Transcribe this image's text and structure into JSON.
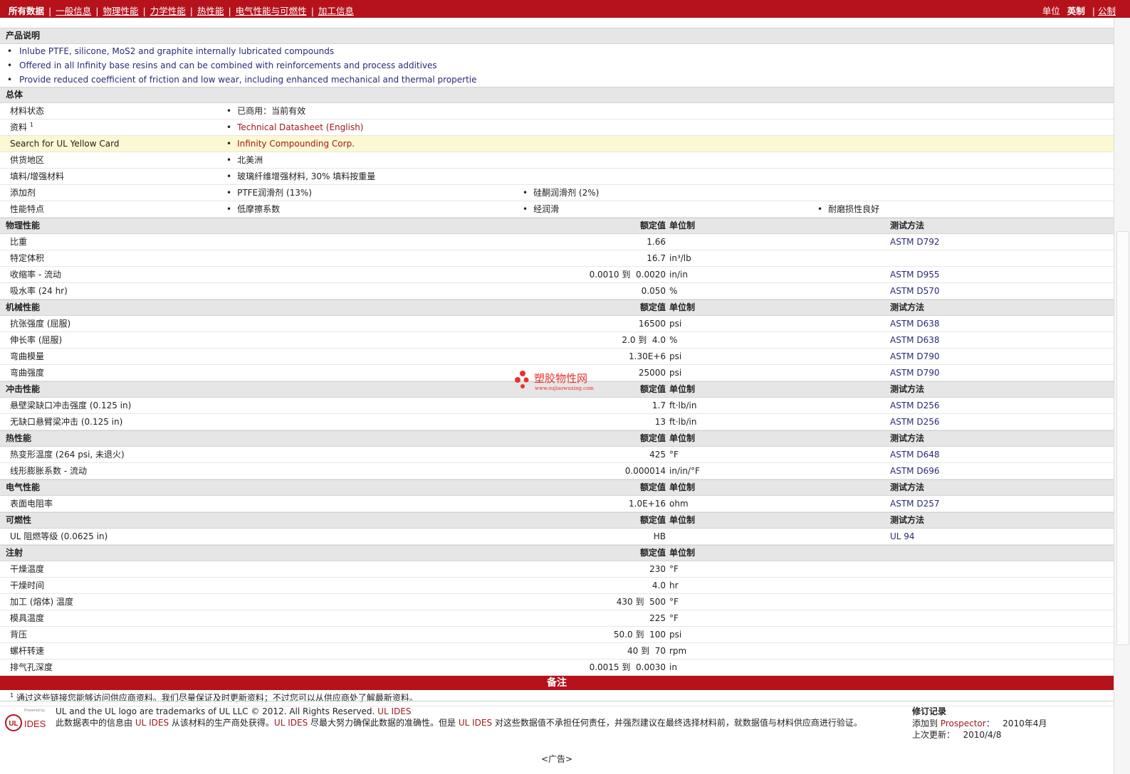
{
  "topbar": {
    "nav": [
      "所有数据",
      "一般信息",
      "物理性能",
      "力学性能",
      "热性能",
      "电气性能与可燃性",
      "加工信息"
    ],
    "units_label": "单位",
    "unit_selected": "英制",
    "unit_other": "公制",
    "bg_color": "#b5121b"
  },
  "product": {
    "heading": "产品说明",
    "bullets": [
      "Inlube PTFE, silicone, MoS2 and graphite internally lubricated compounds",
      "Offered in all Infinity base resins and can be combined with reinforcements and process additives",
      "Provide reduced coefficient of friction and low wear, including enhanced mechanical and thermal propertie"
    ]
  },
  "general": {
    "heading": "总体",
    "rows": [
      {
        "label": "材料状态",
        "sup": "",
        "cols": [
          "已商用：当前有效"
        ],
        "link": false,
        "hl": false
      },
      {
        "label": "资料",
        "sup": "1",
        "cols": [
          "Technical Datasheet (English)"
        ],
        "link": true,
        "hl": false
      },
      {
        "label": "Search for UL Yellow Card",
        "sup": "",
        "cols": [
          "Infinity Compounding Corp."
        ],
        "link": true,
        "hl": true
      },
      {
        "label": "供货地区",
        "sup": "",
        "cols": [
          "北美洲"
        ],
        "link": false,
        "hl": false
      },
      {
        "label": "填料/增强材料",
        "sup": "",
        "cols": [
          "玻璃纤维增强材料, 30% 填料按重量"
        ],
        "link": false,
        "hl": false
      },
      {
        "label": "添加剂",
        "sup": "",
        "cols": [
          "PTFE润滑剂 (13%)",
          "硅酮润滑剂 (2%)"
        ],
        "link": false,
        "hl": false
      },
      {
        "label": "性能特点",
        "sup": "",
        "cols": [
          "低摩擦系数",
          "经润滑",
          "耐磨损性良好"
        ],
        "link": false,
        "hl": false
      }
    ]
  },
  "headers": {
    "nominal": "额定值",
    "unit": "单位制",
    "method": "测试方法"
  },
  "sections": [
    {
      "name": "physical",
      "title": "物理性能",
      "show_method": true,
      "rows": [
        {
          "label": "比重",
          "value": "1.66",
          "unit": "",
          "method": "ASTM D792"
        },
        {
          "label": "特定体积",
          "value": "16.7",
          "unit": "in³/lb",
          "method": ""
        },
        {
          "label": "收缩率 - 流动",
          "value": "0.0010 到  0.0020",
          "unit": "in/in",
          "method": "ASTM D955"
        },
        {
          "label": "吸水率 (24 hr)",
          "value": "0.050",
          "unit": "%",
          "method": "ASTM D570"
        }
      ]
    },
    {
      "name": "mechanical",
      "title": "机械性能",
      "show_method": true,
      "rows": [
        {
          "label": "抗张强度 (屈服)",
          "value": "16500",
          "unit": "psi",
          "method": "ASTM D638"
        },
        {
          "label": "伸长率 (屈服)",
          "value": "2.0 到  4.0",
          "unit": "%",
          "method": "ASTM D638"
        },
        {
          "label": "弯曲模量",
          "value": "1.30E+6",
          "unit": "psi",
          "method": "ASTM D790"
        },
        {
          "label": "弯曲强度",
          "value": "25000",
          "unit": "psi",
          "method": "ASTM D790"
        }
      ]
    },
    {
      "name": "impact",
      "title": "冲击性能",
      "show_method": true,
      "rows": [
        {
          "label": "悬壁梁缺口冲击强度 (0.125 in)",
          "value": "1.7",
          "unit": "ft·lb/in",
          "method": "ASTM D256"
        },
        {
          "label": "无缺口悬臂梁冲击 (0.125 in)",
          "value": "13",
          "unit": "ft·lb/in",
          "method": "ASTM D256"
        }
      ]
    },
    {
      "name": "thermal",
      "title": "热性能",
      "show_method": true,
      "rows": [
        {
          "label": "热变形温度 (264 psi, 未退火)",
          "value": "425",
          "unit": "°F",
          "method": "ASTM D648"
        },
        {
          "label": "线形膨胀系数 - 流动",
          "value": "0.000014",
          "unit": "in/in/°F",
          "method": "ASTM D696"
        }
      ]
    },
    {
      "name": "electrical",
      "title": "电气性能",
      "show_method": true,
      "rows": [
        {
          "label": "表面电阻率",
          "value": "1.0E+16",
          "unit": "ohm",
          "method": "ASTM D257"
        }
      ]
    },
    {
      "name": "flammability",
      "title": "可燃性",
      "show_method": true,
      "rows": [
        {
          "label": "UL 阻燃等级 (0.0625 in)",
          "value": "HB",
          "unit": "",
          "method": "UL 94"
        }
      ]
    },
    {
      "name": "injection",
      "title": "注射",
      "show_method": false,
      "rows": [
        {
          "label": "干燥温度",
          "value": "230",
          "unit": "°F",
          "method": ""
        },
        {
          "label": "干燥时间",
          "value": "4.0",
          "unit": "hr",
          "method": ""
        },
        {
          "label": "加工 (熔体) 温度",
          "value": "430 到  500",
          "unit": "°F",
          "method": ""
        },
        {
          "label": "模具温度",
          "value": "225",
          "unit": "°F",
          "method": ""
        },
        {
          "label": "背压",
          "value": "50.0 到  100",
          "unit": "psi",
          "method": ""
        },
        {
          "label": "螺杆转速",
          "value": "40 到  70",
          "unit": "rpm",
          "method": ""
        },
        {
          "label": "排气孔深度",
          "value": "0.0015 到  0.0030",
          "unit": "in",
          "method": ""
        }
      ]
    }
  ],
  "notes": {
    "heading": "备注",
    "sup": "1",
    "text": "通过这些链接您能够访问供应商资料。我们尽量保证及时更新资料；不过您可以从供应商处了解最新资料。"
  },
  "footer": {
    "logo_powered": "Powered by",
    "logo_ul": "UL",
    "logo_ides": "IDES",
    "line1_a": "UL and the UL logo are trademarks of UL LLC © 2012. All Rights Reserved. ",
    "line1_link": "UL IDES",
    "line2_a": "此数据表中的信息由 ",
    "line2_link1": "UL IDES",
    "line2_b": " 从该材料的生产商处获得。",
    "line2_link2": "UL IDES",
    "line2_c": " 尽最大努力确保此数据的准确性。但是 ",
    "line2_link3": "UL IDES",
    "line2_d": " 对这些数据值不承担任何责任，并强烈建议在最终选择材料前，就数据值与材料供应商进行验证。",
    "rev_title": "修订记录",
    "rev_added_label": "添加到 ",
    "rev_added_link": "Prospector",
    "rev_added_colon": "：",
    "rev_added_date": "2010年4月",
    "rev_updated_label": "上次更新：",
    "rev_updated_date": "2010/4/8"
  },
  "ad": "<广告>",
  "watermark": {
    "title": "塑胶物性网",
    "url": "www.sujiaowuxing.com"
  }
}
